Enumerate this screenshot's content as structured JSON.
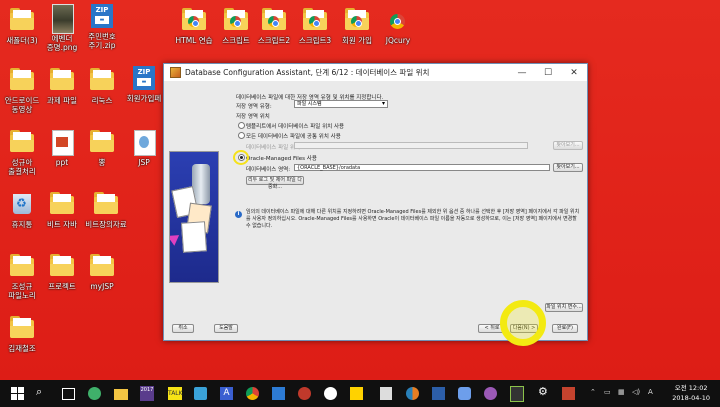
{
  "desktop": {
    "icons": [
      {
        "label": "새폴더(3)",
        "kind": "folder"
      },
      {
        "label": "에벤더\n증명.png",
        "kind": "photo"
      },
      {
        "label": "주민번호\n주기.zip",
        "kind": "zip"
      },
      {
        "label": "HTML 연습",
        "kind": "chrome"
      },
      {
        "label": "스크립트",
        "kind": "chrome"
      },
      {
        "label": "스크립트2",
        "kind": "chrome"
      },
      {
        "label": "스크립트3",
        "kind": "chrome"
      },
      {
        "label": "회원 가입",
        "kind": "chrome"
      },
      {
        "label": "JQcury",
        "kind": "chrome"
      },
      {
        "label": "안드로이드\n동영상",
        "kind": "folder"
      },
      {
        "label": "과제 파일",
        "kind": "folder"
      },
      {
        "label": "리눅스",
        "kind": "folder"
      },
      {
        "label": "회원가입페",
        "kind": "zip"
      },
      {
        "label": "성규아\n출결처리",
        "kind": "folder"
      },
      {
        "label": "ppt",
        "kind": "ppt"
      },
      {
        "label": "뿡",
        "kind": "folder"
      },
      {
        "label": "JSP",
        "kind": "jsp"
      },
      {
        "label": "휴지통",
        "kind": "recycle"
      },
      {
        "label": "비트 자바",
        "kind": "folder"
      },
      {
        "label": "비트장의자료",
        "kind": "folder"
      },
      {
        "label": "조성규\n파일노리",
        "kind": "folder"
      },
      {
        "label": "프로젝트",
        "kind": "folder"
      },
      {
        "label": "myJSP",
        "kind": "folder"
      },
      {
        "label": "김재철조",
        "kind": "folder"
      }
    ]
  },
  "window": {
    "title": "Database Configuration Assistant, 단계 6/12 : 데이터베이스 파일 위치",
    "minimize": "—",
    "maximize": "☐",
    "close": "✕",
    "intro": "데이터베이스 파일에 대한 저장 영역 유형 및 위치를 지정합니다.",
    "storage_type_label": "저장 영역 유형:",
    "storage_type_value": "파일 시스템",
    "storage_location_label": "저장 영역 위치",
    "opt_template": "템플리트에서 데이터베이스 파일 위치 사용",
    "opt_common": "모든 데이터베이스 파일에 공통 위치 사용",
    "db_file_location_label_disabled": "데이터베이스 파일 위치:",
    "browse_disabled": "찾아보기...",
    "opt_omf": "Oracle-Managed Files 사용",
    "db_area_label": "데이터베이스 영역:",
    "db_area_value": "{ORACLE_BASE}/oradata",
    "browse": "찾아보기...",
    "multiplex_button": "리두 로그 및 제어 파일 다중화...",
    "info_text": "임의의 데이터베이스 파일에 대해 다른 위치를 지정하려면 Oracle-Managed Files를 제외한 위 옵션 중 하나를 선택한 후 [저장 영역] 페이지에서 각 파일 위치를 사용자 정의하십시오. Oracle-Managed Files를 사용하면 Oracle이 데이터베이스 파일 이름을 자동으로 생성하므로, 이는 [저장 영역] 페이지에서 변경할 수 없습니다.",
    "file_location_vars": "파일 위치 변수...",
    "cancel": "취소",
    "help": "도움말",
    "back": "< 뒤로",
    "next": "다음(N) >",
    "finish": "완료(F)"
  },
  "taskbar": {
    "badge": "2017",
    "lang": "A",
    "time": "오전 12:02",
    "date": "2018-04-10"
  },
  "colors": {
    "desktop": "#e2231a",
    "highlight": "#f3ea12",
    "taskbar": "#101010"
  }
}
